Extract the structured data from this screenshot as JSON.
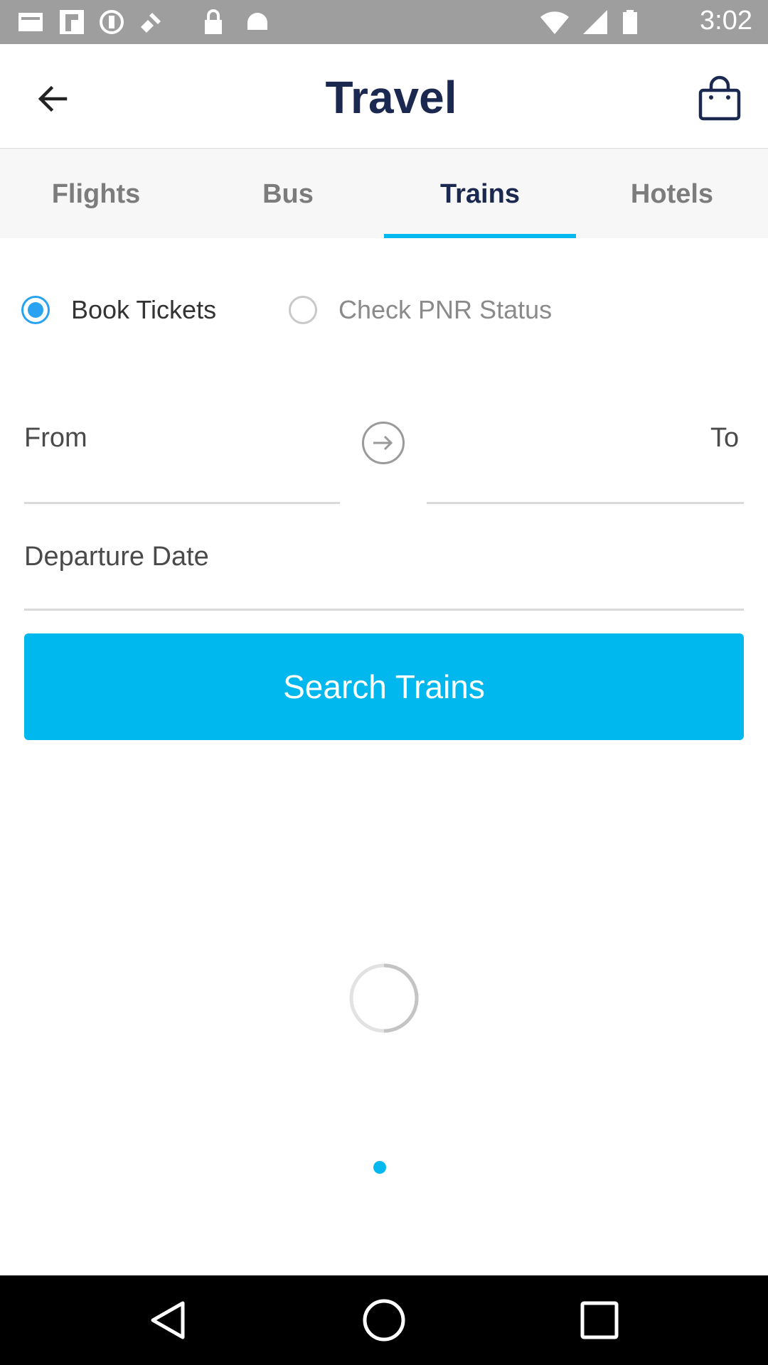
{
  "status_bar": {
    "time": "3:02",
    "icons": [
      "cast-icon",
      "flipboard-icon",
      "data-saver-icon",
      "satellite-icon",
      "lock-icon",
      "android-icon"
    ],
    "right_icons": [
      "wifi-icon",
      "signal-icon",
      "battery-icon"
    ]
  },
  "app_bar": {
    "title": "Travel",
    "back_icon": "arrow-left-icon",
    "bag_icon": "shopping-bag-icon"
  },
  "tabs": [
    {
      "label": "Flights",
      "active": false
    },
    {
      "label": "Bus",
      "active": false
    },
    {
      "label": "Trains",
      "active": true
    },
    {
      "label": "Hotels",
      "active": false
    }
  ],
  "mode": {
    "options": [
      {
        "label": "Book Tickets",
        "selected": true
      },
      {
        "label": "Check PNR Status",
        "selected": false
      }
    ]
  },
  "form": {
    "from_label": "From",
    "to_label": "To",
    "swap_icon": "arrow-right-circle-icon",
    "departure_label": "Departure Date",
    "search_button": "Search Trains"
  },
  "colors": {
    "accent": "#05b8ee",
    "title": "#1b2850",
    "radio": "#2aa2f2"
  }
}
